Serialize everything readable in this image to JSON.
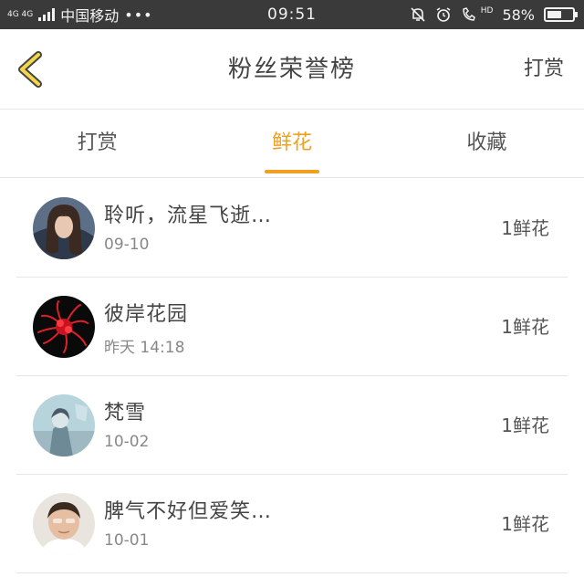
{
  "status_bar": {
    "network": "4G 4G",
    "carrier": "中国移动",
    "more": "•••",
    "time": "09:51",
    "hd": "HD",
    "battery_percent": "58%",
    "battery_level": 0.58
  },
  "header": {
    "title": "粉丝荣誉榜",
    "right_link": "打赏",
    "back_icon": "chevron-left-icon",
    "back_icon_color": "#f3d64a"
  },
  "tabs": [
    {
      "label": "打赏",
      "active": false
    },
    {
      "label": "鲜花",
      "active": true
    },
    {
      "label": "收藏",
      "active": false
    }
  ],
  "accent_color": "#f0a020",
  "fans": [
    {
      "name": "聆听，流星飞逝…",
      "date": "09-10",
      "gift": "1鲜花",
      "avatar": "girl-portrait-avatar"
    },
    {
      "name": "彼岸花园",
      "date": "昨天 14:18",
      "gift": "1鲜花",
      "avatar": "red-spider-lily-avatar"
    },
    {
      "name": "梵雪",
      "date": "10-02",
      "gift": "1鲜花",
      "avatar": "misty-portrait-avatar"
    },
    {
      "name": "脾气不好但爱笑…",
      "date": "10-01",
      "gift": "1鲜花",
      "avatar": "child-portrait-avatar"
    }
  ]
}
